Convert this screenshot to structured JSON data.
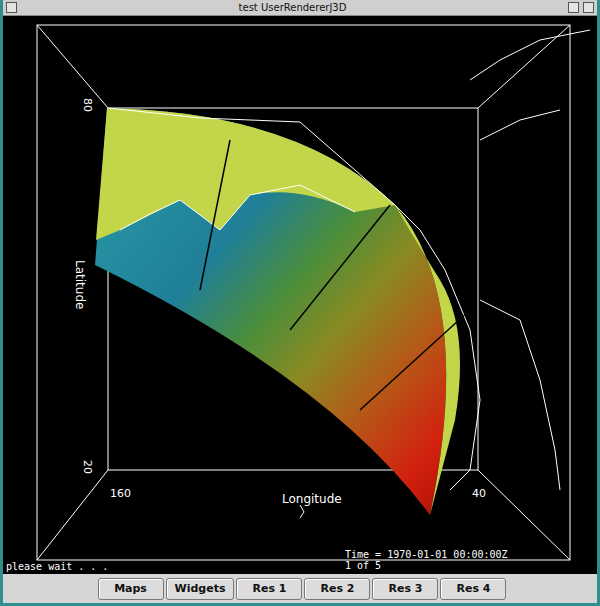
{
  "window": {
    "title": "test UserRendererJ3D"
  },
  "axes": {
    "latitude": {
      "label": "Latitude",
      "max": "80",
      "min": "20"
    },
    "longitude": {
      "label": "Longitude",
      "min": "160",
      "max": "40"
    }
  },
  "status": {
    "message": "please wait . . .",
    "time": "Time = 1970-01-01 00:00:00Z",
    "frame": "1 of 5"
  },
  "buttons": [
    "Maps",
    "Widgets",
    "Res 1",
    "Res 2",
    "Res 3",
    "Res 4"
  ]
}
